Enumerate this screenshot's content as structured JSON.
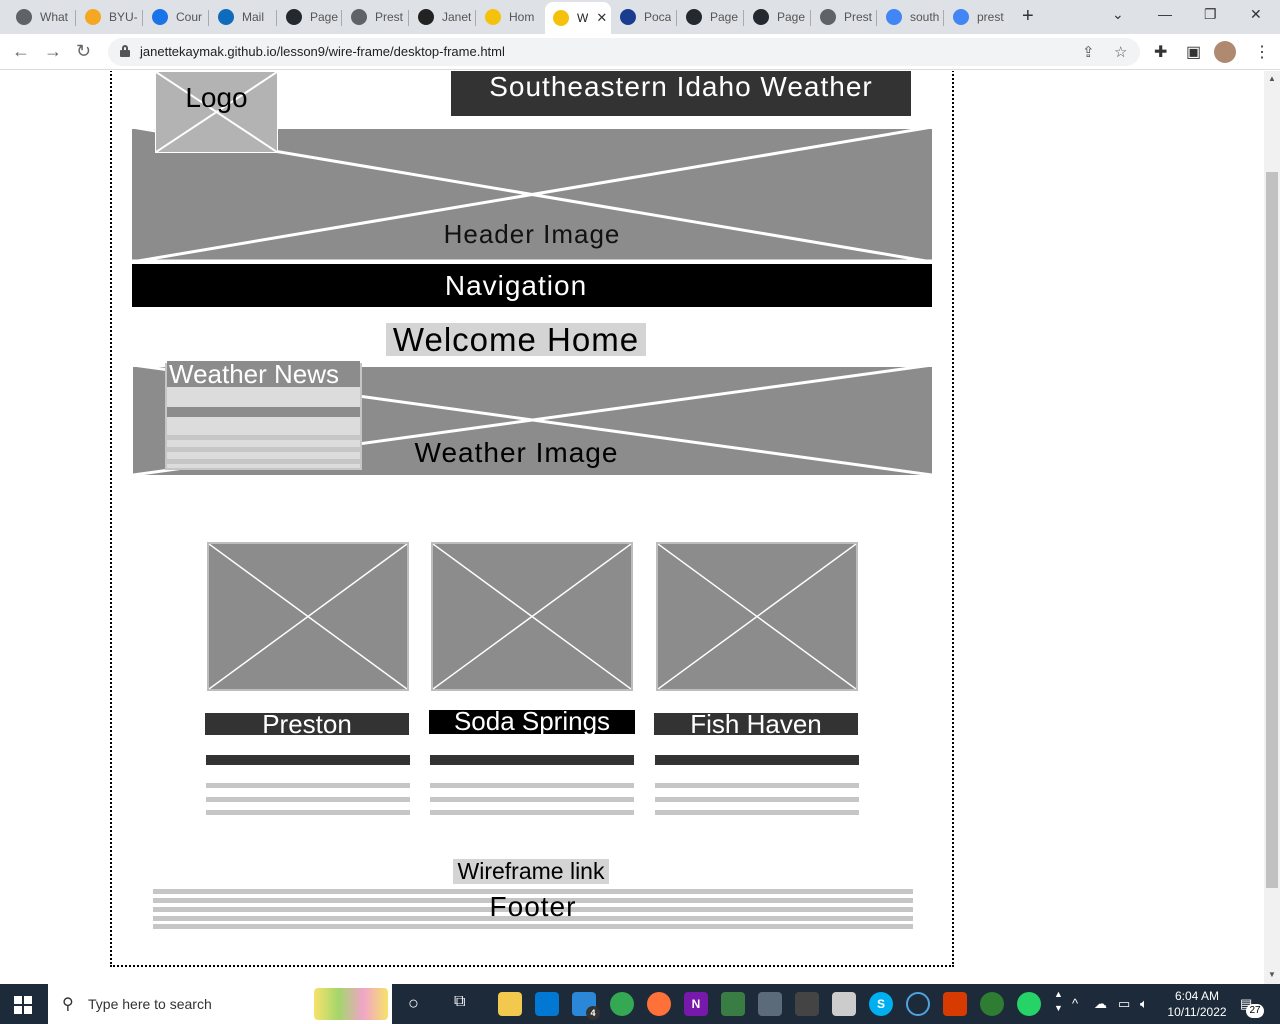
{
  "browser": {
    "tabs": [
      {
        "label": "What",
        "icon": "chrome-icon",
        "color": "#5f6368"
      },
      {
        "label": "BYU-",
        "icon": "byu-icon",
        "color": "#f5a623"
      },
      {
        "label": "Cour",
        "icon": "bar-chart-icon",
        "color": "#1a73e8"
      },
      {
        "label": "Mail",
        "icon": "outlook-icon",
        "color": "#0f6cbd"
      },
      {
        "label": "Page",
        "icon": "github-icon",
        "color": "#24292f"
      },
      {
        "label": "Prest",
        "icon": "globe-icon",
        "color": "#5f6368"
      },
      {
        "label": "Janet",
        "icon": "codepen-icon",
        "color": "#222222"
      },
      {
        "label": "Hom",
        "icon": "weather-icon",
        "color": "#f4c20d"
      },
      {
        "label": "W",
        "icon": "weather-icon",
        "color": "#f4c20d"
      },
      {
        "label": "Poca",
        "icon": "city-icon",
        "color": "#1a3d8f"
      },
      {
        "label": "Page",
        "icon": "github-icon",
        "color": "#24292f"
      },
      {
        "label": "Page",
        "icon": "github-icon",
        "color": "#24292f"
      },
      {
        "label": "Prest",
        "icon": "globe-icon",
        "color": "#5f6368"
      },
      {
        "label": "south",
        "icon": "google-icon",
        "color": "#4285f4"
      },
      {
        "label": "prest",
        "icon": "google-icon",
        "color": "#4285f4"
      }
    ],
    "active_tab_index": 8,
    "url": "janettekaymak.github.io/lesson9/wire-frame/desktop-frame.html"
  },
  "wireframe": {
    "logo": "Logo",
    "site_title": "Southeastern Idaho Weather",
    "header_image": "Header Image",
    "navigation": "Navigation",
    "welcome": "Welcome Home",
    "weather_news": "Weather News",
    "weather_image": "Weather Image",
    "towns": [
      "Preston",
      "Soda Springs",
      "Fish Haven"
    ],
    "wireframe_link": "Wireframe link",
    "footer": "Footer"
  },
  "taskbar": {
    "search_placeholder": "Type here to search",
    "time": "6:04 AM",
    "date": "10/11/2022",
    "notification_count": "27",
    "mail_badge": "4"
  }
}
